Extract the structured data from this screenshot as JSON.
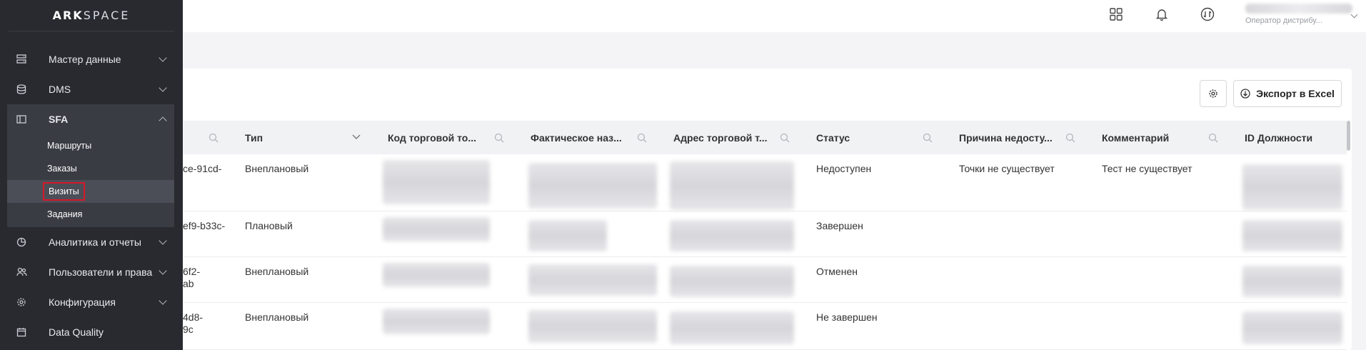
{
  "brand": {
    "bold": "ARK",
    "light": "SPACE"
  },
  "sidebar": {
    "items": [
      {
        "label": "Мастер данные",
        "icon": "database-list-icon"
      },
      {
        "label": "DMS",
        "icon": "stack-icon"
      },
      {
        "label": "SFA",
        "icon": "panel-icon",
        "expanded": true,
        "children": [
          "Маршруты",
          "Заказы",
          "Визиты",
          "Задания"
        ],
        "active_child": "Визиты"
      },
      {
        "label": "Аналитика и отчеты",
        "icon": "chart-pie-icon"
      },
      {
        "label": "Пользователи и права",
        "icon": "users-icon"
      },
      {
        "label": "Конфигурация",
        "icon": "gear-icon"
      },
      {
        "label": "Data Quality",
        "icon": "calendar-icon"
      }
    ]
  },
  "topbar": {
    "user_role": "Оператор дистрибу..."
  },
  "toolbar": {
    "export_label": "Экспорт в Excel"
  },
  "table": {
    "columns": [
      "Тип",
      "Код торговой то...",
      "Фактическое наз...",
      "Адрес торговой т...",
      "Статус",
      "Причина недосту...",
      "Комментарий",
      "ID Должности"
    ],
    "rows": [
      {
        "id_fragment": [
          "ce-91cd-",
          ""
        ],
        "type": "Внеплановый",
        "status": "Недоступен",
        "reason": "Точки не существует",
        "comment": "Тест не существует"
      },
      {
        "id_fragment": [
          "ef9-b33c-",
          ""
        ],
        "type": "Плановый",
        "status": "Завершен",
        "reason": "",
        "comment": ""
      },
      {
        "id_fragment": [
          "6f2-",
          "ab"
        ],
        "type": "Внеплановый",
        "status": "Отменен",
        "reason": "",
        "comment": ""
      },
      {
        "id_fragment": [
          "4d8-",
          "9c"
        ],
        "type": "Внеплановый",
        "status": "Не завершен",
        "reason": "",
        "comment": ""
      }
    ]
  },
  "colors": {
    "sidebar_bg": "#282a30",
    "active_outline": "#d6182a"
  }
}
